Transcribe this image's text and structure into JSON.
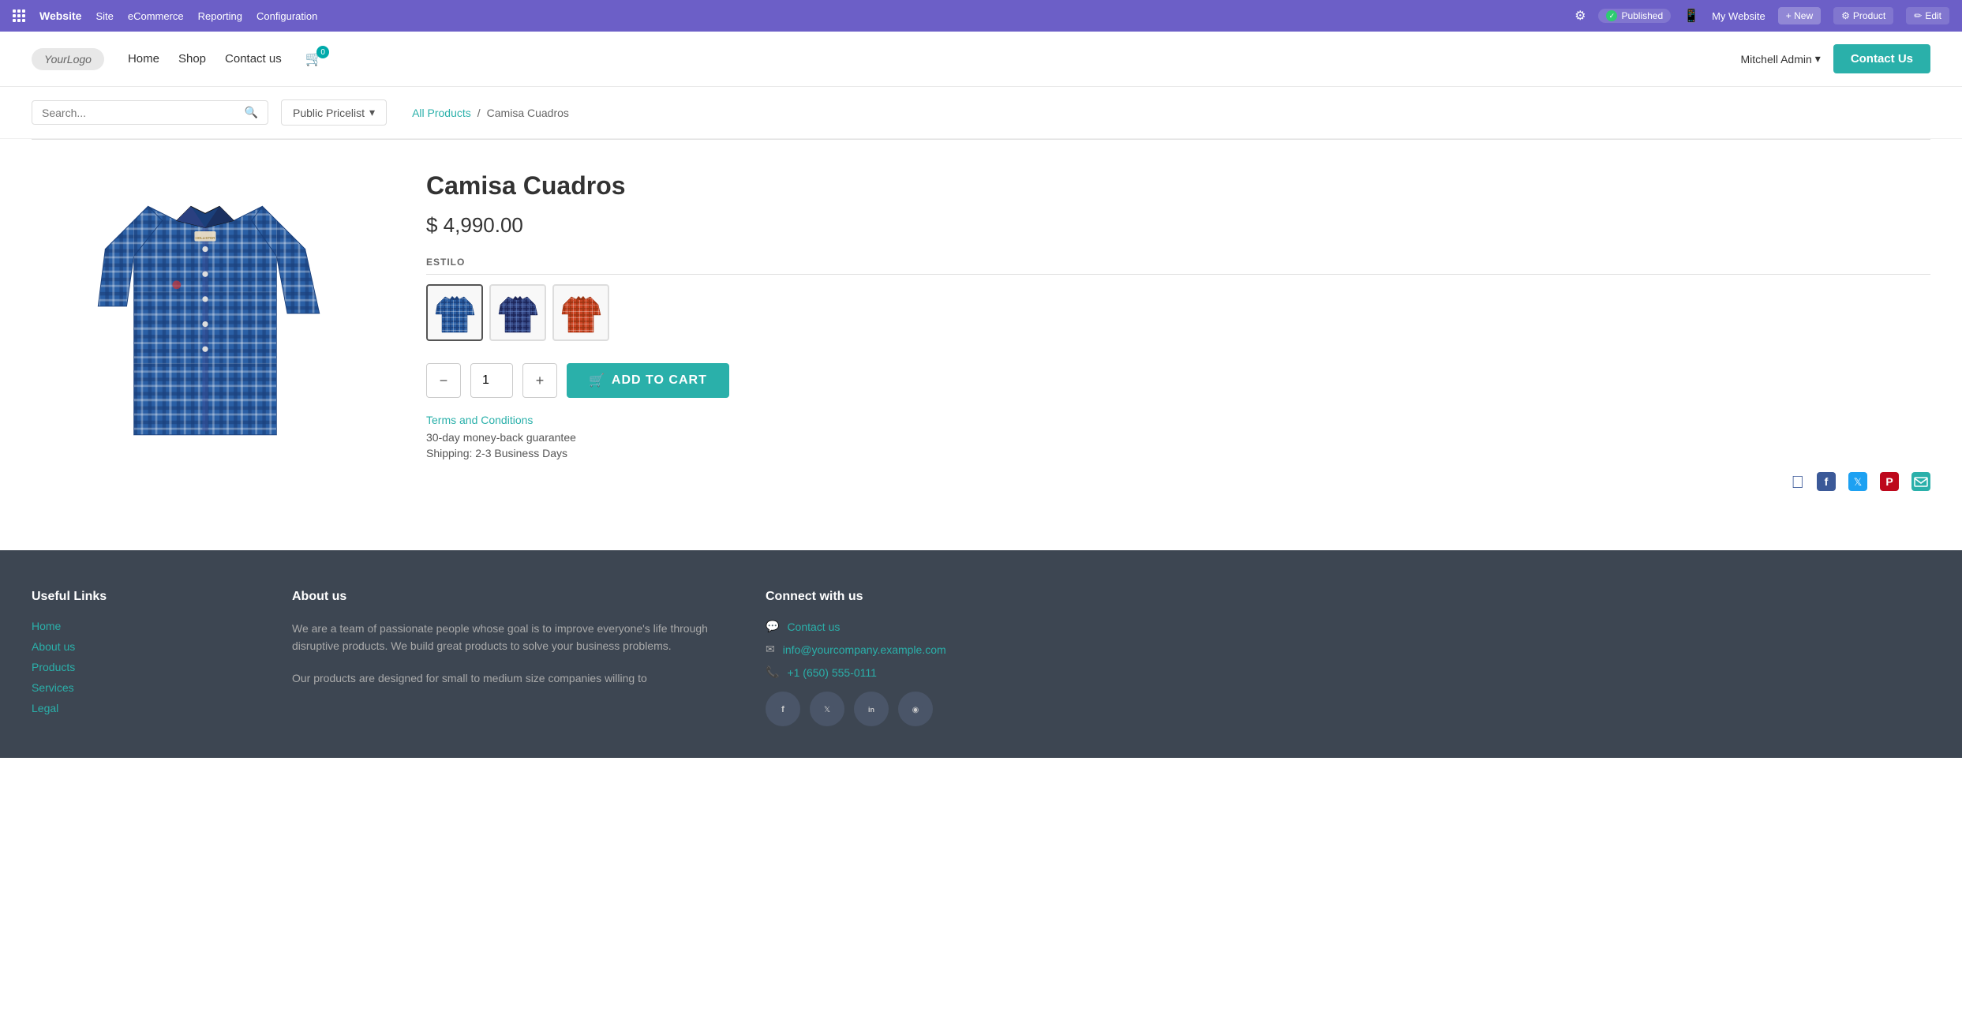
{
  "adminBar": {
    "appName": "Website",
    "nav": [
      "Site",
      "eCommerce",
      "Reporting",
      "Configuration"
    ],
    "publishedLabel": "Published",
    "myWebsite": "My Website",
    "newLabel": "+ New",
    "productLabel": "Product",
    "editLabel": "Edit"
  },
  "mainNav": {
    "logoText": "YourLogo",
    "links": [
      "Home",
      "Shop",
      "Contact us"
    ],
    "cartCount": "0",
    "userLabel": "Mitchell Admin",
    "contactUsBtn": "Contact Us"
  },
  "searchBar": {
    "placeholder": "Search...",
    "pricelistLabel": "Public Pricelist"
  },
  "breadcrumb": {
    "allProducts": "All Products",
    "separator": "/",
    "current": "Camisa Cuadros"
  },
  "product": {
    "title": "Camisa Cuadros",
    "price": "$ 4,990.00",
    "estiloLabel": "ESTILO",
    "quantity": "1",
    "addToCartLabel": "ADD TO CART",
    "termsLabel": "Terms and Conditions",
    "guarantee": "30-day money-back guarantee",
    "shipping": "Shipping: 2-3 Business Days"
  },
  "footer": {
    "usefulLinksTitle": "Useful Links",
    "links": [
      "Home",
      "About us",
      "Products",
      "Services",
      "Legal"
    ],
    "aboutTitle": "About us",
    "aboutText1": "We are a team of passionate people whose goal is to improve everyone's life through disruptive products. We build great products to solve your business problems.",
    "aboutText2": "Our products are designed for small to medium size companies willing to",
    "connectTitle": "Connect with us",
    "contactUs": "Contact us",
    "email": "info@yourcompany.example.com",
    "phone": "+1 (650) 555-0111"
  }
}
